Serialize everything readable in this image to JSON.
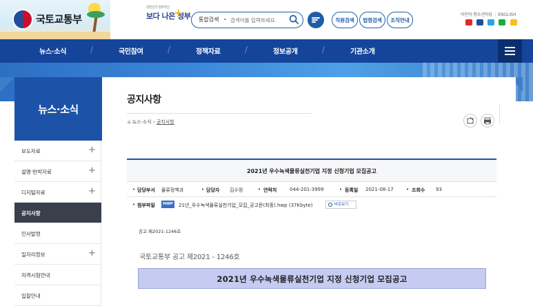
{
  "header": {
    "logo_text": "국토교통부",
    "better_gov": "보다 나은 정부",
    "better_gov_sub": "대한민국 정부혁신",
    "search": {
      "scope": "통합검색",
      "placeholder": "검색어를 입력하세요."
    },
    "pills": [
      "직원검색",
      "법령검색",
      "조직안내"
    ],
    "util_links": [
      "어린이·청소년마당",
      "ENGLISH"
    ],
    "sns": [
      {
        "name": "youtube",
        "color": "#e02a20"
      },
      {
        "name": "facebook",
        "color": "#1b4fa0"
      },
      {
        "name": "twitter",
        "color": "#2aa3e8"
      },
      {
        "name": "blog",
        "color": "#1aac3a"
      },
      {
        "name": "kakao",
        "color": "#f3c21f"
      }
    ]
  },
  "nav": {
    "items": [
      "뉴스·소식",
      "국민참여",
      "정책자료",
      "정보공개",
      "기관소개"
    ]
  },
  "sidebar": {
    "title": "뉴스·소식",
    "items": [
      {
        "label": "보도자료",
        "has_plus": true
      },
      {
        "label": "설명·반박자료",
        "has_plus": true
      },
      {
        "label": "디지털자료",
        "has_plus": true
      },
      {
        "label": "공지사항",
        "has_plus": false,
        "active": true
      },
      {
        "label": "인사발령",
        "has_plus": false
      },
      {
        "label": "일자리정보",
        "has_plus": true
      },
      {
        "label": "자격시험안내",
        "has_plus": false
      },
      {
        "label": "입찰안내",
        "has_plus": false
      }
    ]
  },
  "page": {
    "title": "공지사항",
    "breadcrumb": {
      "section": "뉴스·소식",
      "current": "공지사항"
    }
  },
  "article": {
    "title": "2021년 우수녹색물류실천기업 지정 신청기업 모집공고",
    "info": {
      "dept_label": "담당부서",
      "dept": "물류정책과",
      "person_label": "담당자",
      "person": "김수정",
      "phone_label": "연락처",
      "phone": "044-201-3999",
      "date_label": "등록일",
      "date": "2021-08-17",
      "views_label": "조회수",
      "views": "93"
    },
    "attach_label": "첨부파일",
    "attach_type": "HWP",
    "attach_file": "21년_우수녹색물류실천기업_모집_공고문(최종).hwp (37Kbyte)",
    "preview_label": "바로보기",
    "notice_no": "공고 제2021-1246호",
    "notice_line": "국토교통부 공고 제2021 - 1246호",
    "notice_title": "2021년 우수녹색물류실천기업 지정 신청기업 모집공고"
  }
}
